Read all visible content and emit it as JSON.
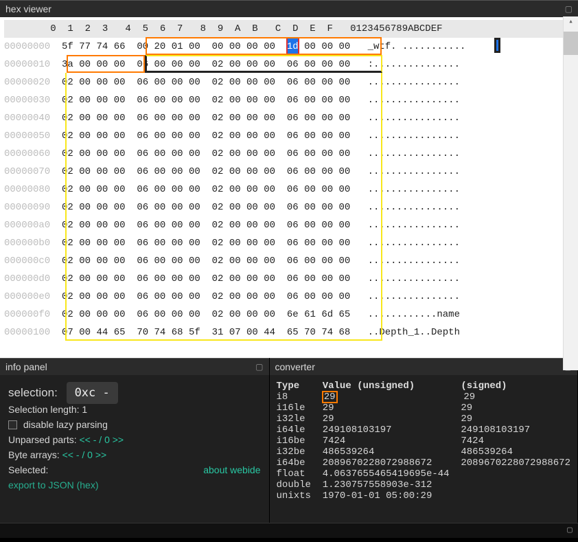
{
  "hexviewer": {
    "title": "hex viewer",
    "col_header": "        0  1  2  3   4  5  6  7   8  9  A  B   C  D  E  F   0123456789ABCDEF",
    "rows": [
      {
        "off": "00000000",
        "b": [
          "5f",
          "77",
          "74",
          "66",
          "00",
          "20",
          "01",
          "00",
          "00",
          "00",
          "00",
          "00",
          "1d",
          "00",
          "00",
          "00"
        ],
        "ascii": "_wtf. ..........."
      },
      {
        "off": "00000010",
        "b": [
          "3a",
          "00",
          "00",
          "00",
          "06",
          "00",
          "00",
          "00",
          "02",
          "00",
          "00",
          "00",
          "06",
          "00",
          "00",
          "00"
        ],
        "ascii": ":..............."
      },
      {
        "off": "00000020",
        "b": [
          "02",
          "00",
          "00",
          "00",
          "06",
          "00",
          "00",
          "00",
          "02",
          "00",
          "00",
          "00",
          "06",
          "00",
          "00",
          "00"
        ],
        "ascii": "................"
      },
      {
        "off": "00000030",
        "b": [
          "02",
          "00",
          "00",
          "00",
          "06",
          "00",
          "00",
          "00",
          "02",
          "00",
          "00",
          "00",
          "06",
          "00",
          "00",
          "00"
        ],
        "ascii": "................"
      },
      {
        "off": "00000040",
        "b": [
          "02",
          "00",
          "00",
          "00",
          "06",
          "00",
          "00",
          "00",
          "02",
          "00",
          "00",
          "00",
          "06",
          "00",
          "00",
          "00"
        ],
        "ascii": "................"
      },
      {
        "off": "00000050",
        "b": [
          "02",
          "00",
          "00",
          "00",
          "06",
          "00",
          "00",
          "00",
          "02",
          "00",
          "00",
          "00",
          "06",
          "00",
          "00",
          "00"
        ],
        "ascii": "................"
      },
      {
        "off": "00000060",
        "b": [
          "02",
          "00",
          "00",
          "00",
          "06",
          "00",
          "00",
          "00",
          "02",
          "00",
          "00",
          "00",
          "06",
          "00",
          "00",
          "00"
        ],
        "ascii": "................"
      },
      {
        "off": "00000070",
        "b": [
          "02",
          "00",
          "00",
          "00",
          "06",
          "00",
          "00",
          "00",
          "02",
          "00",
          "00",
          "00",
          "06",
          "00",
          "00",
          "00"
        ],
        "ascii": "................"
      },
      {
        "off": "00000080",
        "b": [
          "02",
          "00",
          "00",
          "00",
          "06",
          "00",
          "00",
          "00",
          "02",
          "00",
          "00",
          "00",
          "06",
          "00",
          "00",
          "00"
        ],
        "ascii": "................"
      },
      {
        "off": "00000090",
        "b": [
          "02",
          "00",
          "00",
          "00",
          "06",
          "00",
          "00",
          "00",
          "02",
          "00",
          "00",
          "00",
          "06",
          "00",
          "00",
          "00"
        ],
        "ascii": "................"
      },
      {
        "off": "000000a0",
        "b": [
          "02",
          "00",
          "00",
          "00",
          "06",
          "00",
          "00",
          "00",
          "02",
          "00",
          "00",
          "00",
          "06",
          "00",
          "00",
          "00"
        ],
        "ascii": "................"
      },
      {
        "off": "000000b0",
        "b": [
          "02",
          "00",
          "00",
          "00",
          "06",
          "00",
          "00",
          "00",
          "02",
          "00",
          "00",
          "00",
          "06",
          "00",
          "00",
          "00"
        ],
        "ascii": "................"
      },
      {
        "off": "000000c0",
        "b": [
          "02",
          "00",
          "00",
          "00",
          "06",
          "00",
          "00",
          "00",
          "02",
          "00",
          "00",
          "00",
          "06",
          "00",
          "00",
          "00"
        ],
        "ascii": "................"
      },
      {
        "off": "000000d0",
        "b": [
          "02",
          "00",
          "00",
          "00",
          "06",
          "00",
          "00",
          "00",
          "02",
          "00",
          "00",
          "00",
          "06",
          "00",
          "00",
          "00"
        ],
        "ascii": "................"
      },
      {
        "off": "000000e0",
        "b": [
          "02",
          "00",
          "00",
          "00",
          "06",
          "00",
          "00",
          "00",
          "02",
          "00",
          "00",
          "00",
          "06",
          "00",
          "00",
          "00"
        ],
        "ascii": "................"
      },
      {
        "off": "000000f0",
        "b": [
          "02",
          "00",
          "00",
          "00",
          "06",
          "00",
          "00",
          "00",
          "02",
          "00",
          "00",
          "00",
          "6e",
          "61",
          "6d",
          "65"
        ],
        "ascii": "............name"
      },
      {
        "off": "00000100",
        "b": [
          "07",
          "00",
          "44",
          "65",
          "70",
          "74",
          "68",
          "5f",
          "31",
          "07",
          "00",
          "44",
          "65",
          "70",
          "74",
          "68"
        ],
        "ascii": "..Depth_1..Depth"
      }
    ],
    "selected_row": 0,
    "selected_col": 12
  },
  "infopanel": {
    "title": "info panel",
    "selection_label": "selection:",
    "selection_value": "0xc  -",
    "sel_len_label": "Selection length: 1",
    "disable_lazy": "disable lazy parsing",
    "unparsed_label": "Unparsed parts:",
    "unparsed_value": "<< - / 0 >>",
    "bytearrays_label": "Byte arrays:",
    "bytearrays_value": "<< - / 0 >>",
    "selected_label": "Selected:",
    "about": "about webide",
    "export_label": "export to JSON (hex)"
  },
  "converter": {
    "title": "converter",
    "header_type": "Type",
    "header_unsigned": "Value (unsigned)",
    "header_signed": "(signed)",
    "rows": [
      {
        "t": "i8",
        "u": "29",
        "s": "29",
        "hl": true
      },
      {
        "t": "i16le",
        "u": "29",
        "s": "29"
      },
      {
        "t": "i32le",
        "u": "29",
        "s": "29"
      },
      {
        "t": "i64le",
        "u": "249108103197",
        "s": "249108103197"
      },
      {
        "t": "i16be",
        "u": "7424",
        "s": "7424"
      },
      {
        "t": "i32be",
        "u": "486539264",
        "s": "486539264"
      },
      {
        "t": "i64be",
        "u": "2089670228072988672",
        "s": "2089670228072988672"
      },
      {
        "t": "float",
        "u": "4.0637655465419695e-44",
        "s": ""
      },
      {
        "t": "double",
        "u": "1.230757558903e-312",
        "s": ""
      },
      {
        "t": "unixts",
        "u": "1970-01-01 05:00:29",
        "s": ""
      }
    ]
  }
}
